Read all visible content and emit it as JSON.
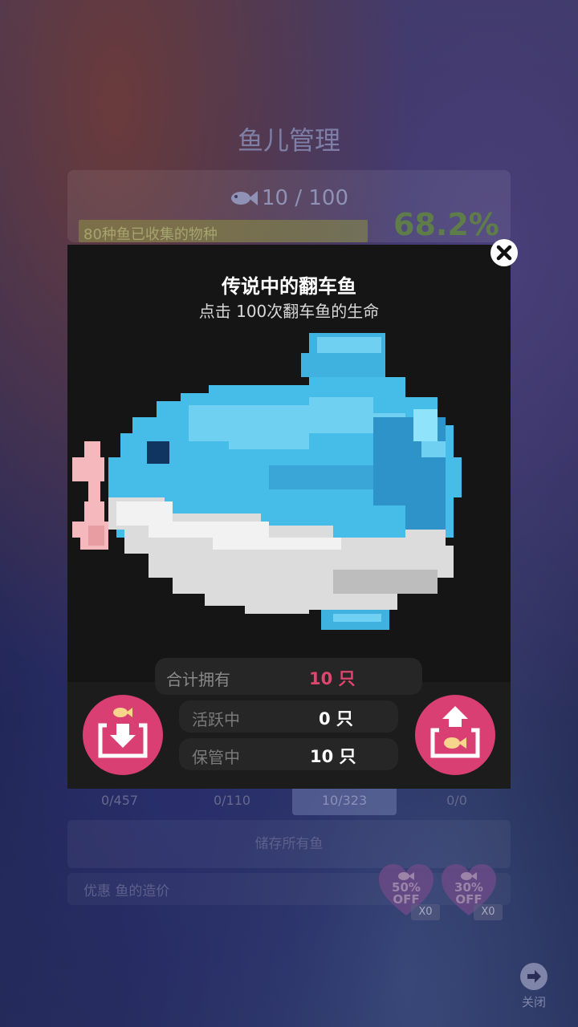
{
  "background": {
    "title": "鱼儿管理",
    "count": "10 / 100",
    "progress_label": "80种鱼已收集的物种",
    "progress_percent": "68.2%",
    "progress_fill": 0.682,
    "tabs": [
      "0/457",
      "0/110",
      "10/323",
      "0/0"
    ],
    "selected_tab": 2,
    "store_all": "储存所有鱼",
    "discount_label": "优惠 鱼的造价",
    "coupons": [
      {
        "percent": "50%",
        "off": "OFF",
        "count": "X0"
      },
      {
        "percent": "30%",
        "off": "OFF",
        "count": "X0"
      }
    ],
    "close_label": "关闭"
  },
  "dialog": {
    "title": "传说中的翻车鱼",
    "subtitle": "点击 100次翻车鱼的生命",
    "total_label": "合计拥有",
    "total_value": "10 只",
    "active_label": "活跃中",
    "active_value": "0 只",
    "stored_label": "保管中",
    "stored_value": "10 只"
  },
  "icons": {
    "close": "close-icon",
    "store_fish": "store-fish-icon",
    "release_fish": "release-fish-icon",
    "fish_count": "fish-icon"
  },
  "colors": {
    "accent_pink": "#d93f72",
    "total_value_pink": "#e0456f",
    "dialog_bg": "#151515"
  }
}
